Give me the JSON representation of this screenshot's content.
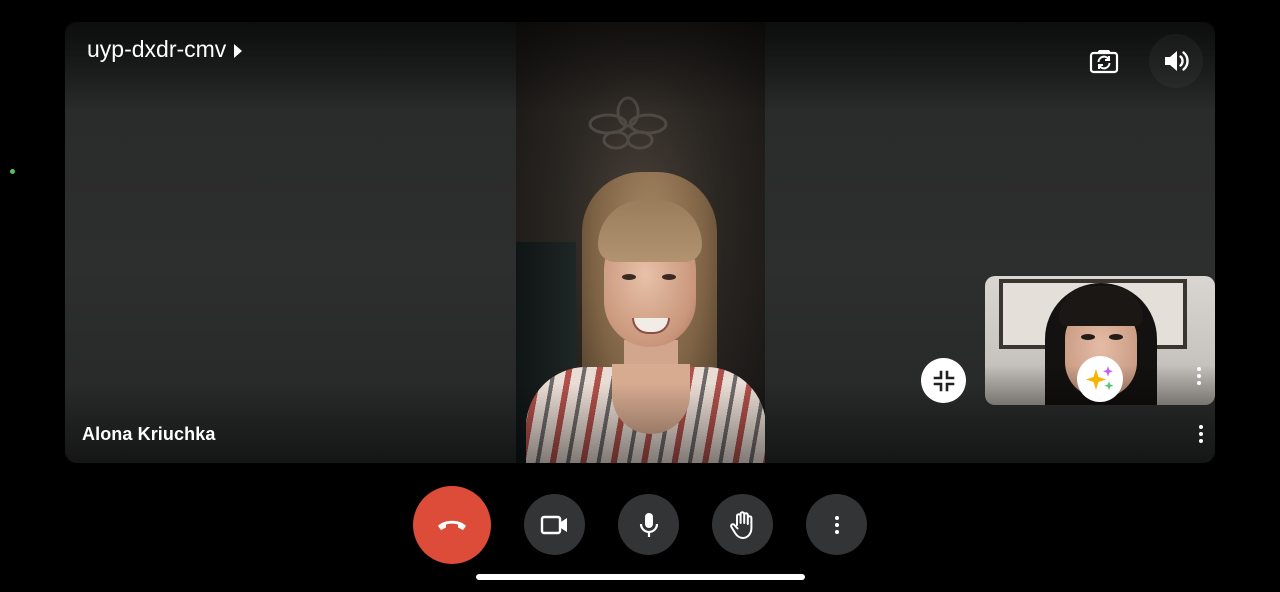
{
  "meeting": {
    "code": "uyp-dxdr-cmv"
  },
  "main_tile": {
    "participant_name": "Alona Kriuchka"
  },
  "top_bar": {
    "icons": [
      "switch-camera-icon",
      "speaker-icon"
    ]
  },
  "self_view": {
    "icons": [
      "effects-sparkle-icon",
      "more-vert-icon"
    ]
  },
  "controls": {
    "buttons": [
      "end-call",
      "camera",
      "microphone",
      "raise-hand",
      "more-options"
    ],
    "colors": {
      "end_call": "#dd4b39",
      "button_bg": "#333436"
    }
  },
  "colors": {
    "background": "#000000",
    "status_dot": "#5bbd5b"
  }
}
